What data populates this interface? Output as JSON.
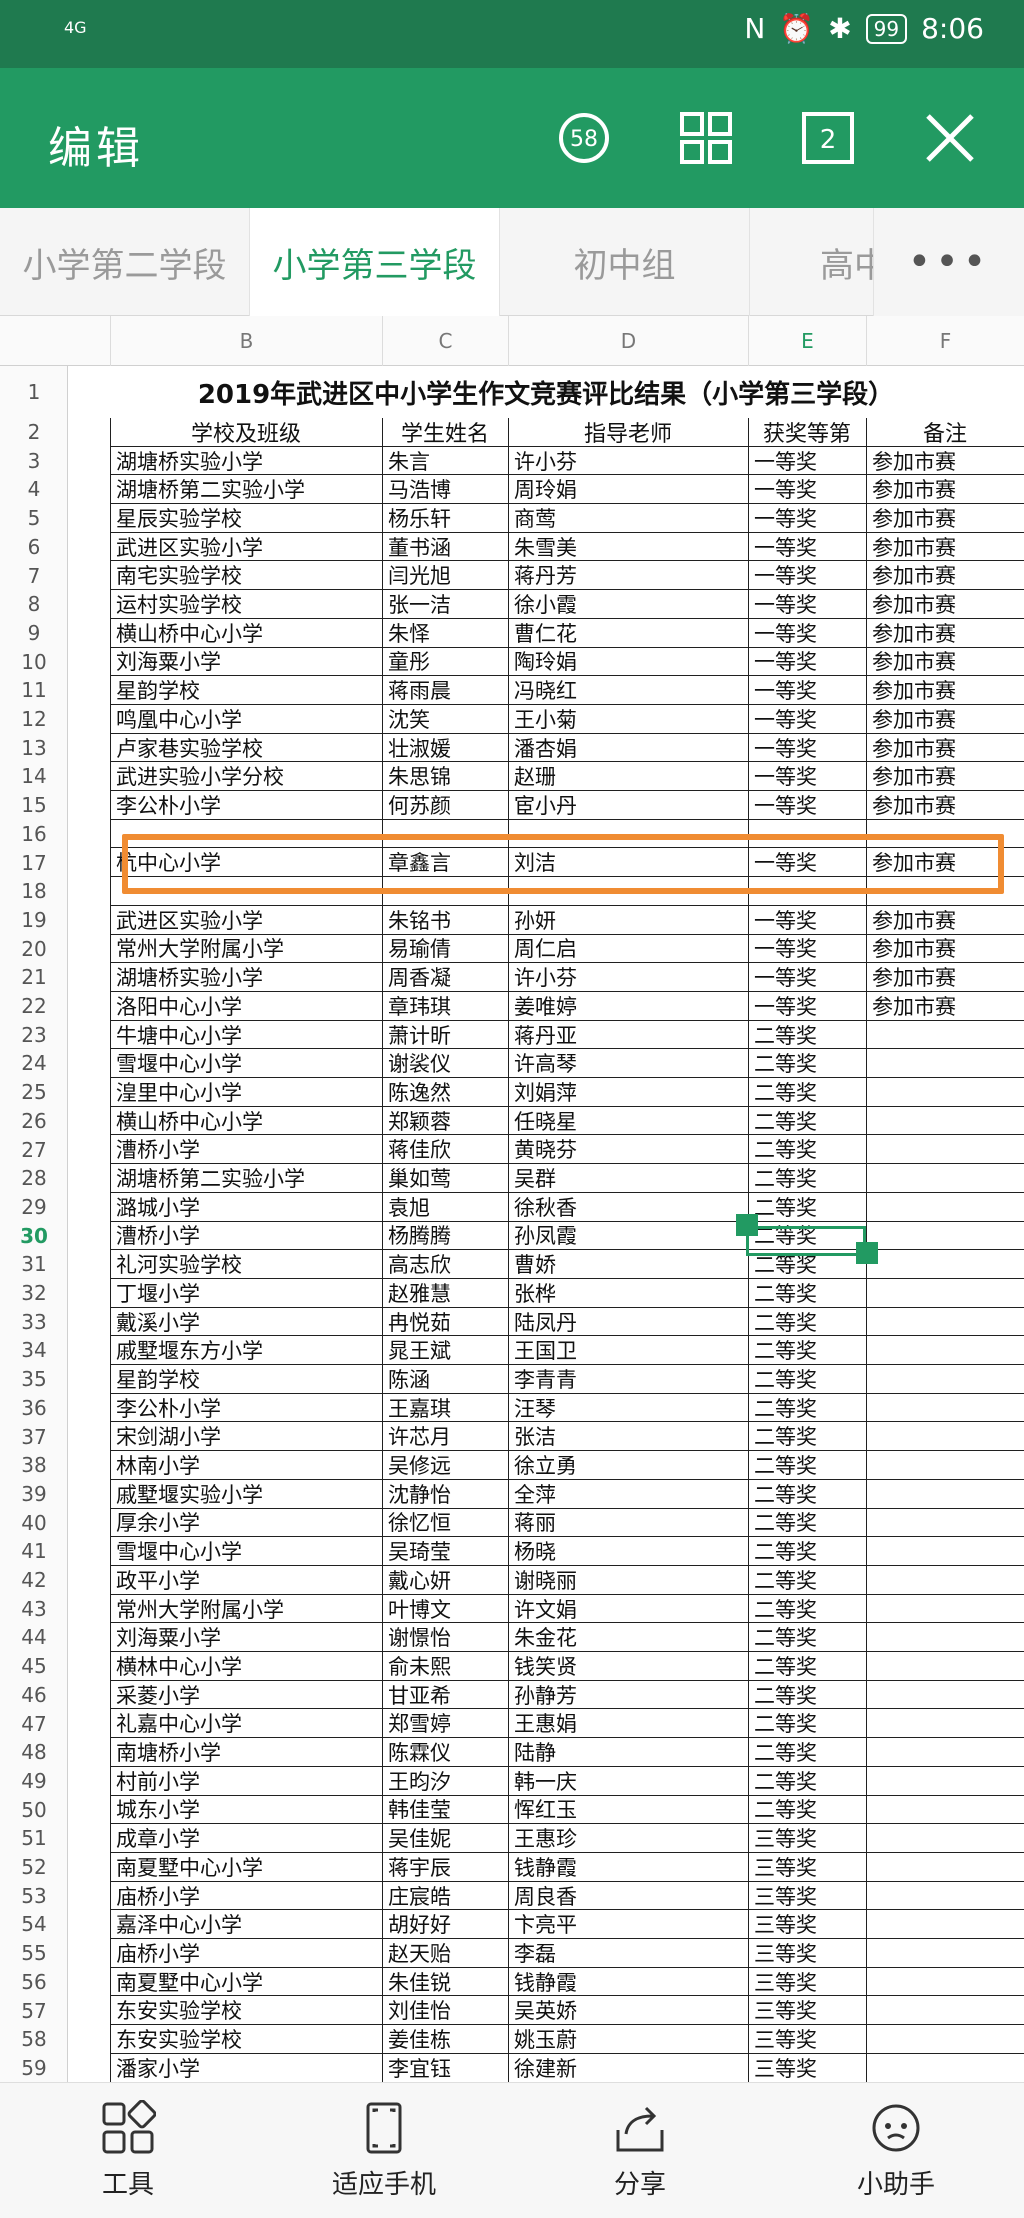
{
  "status_bar": {
    "network": "4G",
    "battery": "99",
    "time": "8:06"
  },
  "app_bar": {
    "title": "编辑",
    "comment_count": "58",
    "page_count": "2"
  },
  "tabs": [
    "小学第二学段",
    "小学第三学段",
    "初中组",
    "高中"
  ],
  "columns": [
    "B",
    "C",
    "D",
    "E",
    "F"
  ],
  "sheet_title": "2019年武进区中小学生作文竞赛评比结果（小学第三学段）",
  "header_row": [
    "学校及班级",
    "学生姓名",
    "指导老师",
    "获奖等第",
    "备注"
  ],
  "rows": [
    [
      "湖塘桥实验小学",
      "朱言",
      "许小芬",
      "一等奖",
      "参加市赛"
    ],
    [
      "湖塘桥第二实验小学",
      "马浩博",
      "周玲娟",
      "一等奖",
      "参加市赛"
    ],
    [
      "星辰实验学校",
      "杨乐轩",
      "商莺",
      "一等奖",
      "参加市赛"
    ],
    [
      "武进区实验小学",
      "董书涵",
      "朱雪美",
      "一等奖",
      "参加市赛"
    ],
    [
      "南宅实验学校",
      "闫光旭",
      "蒋丹芳",
      "一等奖",
      "参加市赛"
    ],
    [
      "运村实验学校",
      "张一洁",
      "徐小霞",
      "一等奖",
      "参加市赛"
    ],
    [
      "横山桥中心小学",
      "朱怿",
      "曹仁花",
      "一等奖",
      "参加市赛"
    ],
    [
      "刘海粟小学",
      "童彤",
      "陶玲娟",
      "一等奖",
      "参加市赛"
    ],
    [
      "星韵学校",
      "蒋雨晨",
      "冯晓红",
      "一等奖",
      "参加市赛"
    ],
    [
      "鸣凰中心小学",
      "沈笑",
      "王小菊",
      "一等奖",
      "参加市赛"
    ],
    [
      "卢家巷实验学校",
      "壮淑媛",
      "潘杏娟",
      "一等奖",
      "参加市赛"
    ],
    [
      "武进实验小学分校",
      "朱思锦",
      "赵珊",
      "一等奖",
      "参加市赛"
    ],
    [
      "李公朴小学",
      "何苏颜",
      "宦小丹",
      "一等奖",
      "参加市赛"
    ],
    [
      "",
      "",
      "",
      "",
      ""
    ],
    [
      "杭中心小学",
      "章鑫言",
      "刘洁",
      "一等奖",
      "参加市赛"
    ],
    [
      "",
      "",
      "",
      "",
      ""
    ],
    [
      "武进区实验小学",
      "朱铭书",
      "孙妍",
      "一等奖",
      "参加市赛"
    ],
    [
      "常州大学附属小学",
      "易瑜倩",
      "周仁启",
      "一等奖",
      "参加市赛"
    ],
    [
      "湖塘桥实验小学",
      "周香凝",
      "许小芬",
      "一等奖",
      "参加市赛"
    ],
    [
      "洛阳中心小学",
      "章玮琪",
      "姜唯婷",
      "一等奖",
      "参加市赛"
    ],
    [
      "牛塘中心小学",
      "萧计昕",
      "蒋丹亚",
      "二等奖",
      ""
    ],
    [
      "雪堰中心小学",
      "谢裟仪",
      "许高琴",
      "二等奖",
      ""
    ],
    [
      "湟里中心小学",
      "陈逸然",
      "刘娟萍",
      "二等奖",
      ""
    ],
    [
      "横山桥中心小学",
      "郑颖蓉",
      "任晓星",
      "二等奖",
      ""
    ],
    [
      "漕桥小学",
      "蒋佳欣",
      "黄晓芬",
      "二等奖",
      ""
    ],
    [
      "湖塘桥第二实验小学",
      "巢如莺",
      "吴群",
      "二等奖",
      ""
    ],
    [
      "潞城小学",
      "袁旭",
      "徐秋香",
      "二等奖",
      ""
    ],
    [
      "漕桥小学",
      "杨腾腾",
      "孙凤霞",
      "二等奖",
      ""
    ],
    [
      "礼河实验学校",
      "高志欣",
      "曹娇",
      "二等奖",
      ""
    ],
    [
      "丁堰小学",
      "赵雅慧",
      "张桦",
      "二等奖",
      ""
    ],
    [
      "戴溪小学",
      "冉悦茹",
      "陆凤丹",
      "二等奖",
      ""
    ],
    [
      "戚墅堰东方小学",
      "晁王斌",
      "王国卫",
      "二等奖",
      ""
    ],
    [
      "星韵学校",
      "陈涵",
      "李青青",
      "二等奖",
      ""
    ],
    [
      "李公朴小学",
      "王嘉琪",
      "汪琴",
      "二等奖",
      ""
    ],
    [
      "宋剑湖小学",
      "许芯月",
      "张洁",
      "二等奖",
      ""
    ],
    [
      "林南小学",
      "吴修远",
      "徐立勇",
      "二等奖",
      ""
    ],
    [
      "戚墅堰实验小学",
      "沈静怡",
      "全萍",
      "二等奖",
      ""
    ],
    [
      "厚余小学",
      "徐忆恒",
      "蒋丽",
      "二等奖",
      ""
    ],
    [
      "雪堰中心小学",
      "吴琦莹",
      "杨晓",
      "二等奖",
      ""
    ],
    [
      "政平小学",
      "戴心妍",
      "谢晓丽",
      "二等奖",
      ""
    ],
    [
      "常州大学附属小学",
      "叶博文",
      "许文娟",
      "二等奖",
      ""
    ],
    [
      "刘海粟小学",
      "谢憬怡",
      "朱金花",
      "二等奖",
      ""
    ],
    [
      "横林中心小学",
      "俞未熙",
      "钱笑贤",
      "二等奖",
      ""
    ],
    [
      "采菱小学",
      "甘亚希",
      "孙静芳",
      "二等奖",
      ""
    ],
    [
      "礼嘉中心小学",
      "郑雪婷",
      "王惠娟",
      "二等奖",
      ""
    ],
    [
      "南塘桥小学",
      "陈霖仪",
      "陆静",
      "二等奖",
      ""
    ],
    [
      "村前小学",
      "王昀汐",
      "韩一庆",
      "二等奖",
      ""
    ],
    [
      "城东小学",
      "韩佳莹",
      "恽红玉",
      "二等奖",
      ""
    ],
    [
      "成章小学",
      "吴佳妮",
      "王惠珍",
      "三等奖",
      ""
    ],
    [
      "南夏墅中心小学",
      "蒋宇辰",
      "钱静霞",
      "三等奖",
      ""
    ],
    [
      "庙桥小学",
      "庄宸皓",
      "周良香",
      "三等奖",
      ""
    ],
    [
      "嘉泽中心小学",
      "胡好好",
      "卞亮平",
      "三等奖",
      ""
    ],
    [
      "庙桥小学",
      "赵天贻",
      "李磊",
      "三等奖",
      ""
    ],
    [
      "南夏墅中心小学",
      "朱佳锐",
      "钱静霞",
      "三等奖",
      ""
    ],
    [
      "东安实验学校",
      "刘佳怡",
      "吴英娇",
      "三等奖",
      ""
    ],
    [
      "东安实验学校",
      "姜佳栋",
      "姚玉蔚",
      "三等奖",
      ""
    ],
    [
      "潘家小学",
      "李宜钰",
      "徐建新",
      "三等奖",
      ""
    ]
  ],
  "bottom_bar": [
    {
      "label": "工具",
      "icon": "tools-icon"
    },
    {
      "label": "适应手机",
      "icon": "fit-phone-icon"
    },
    {
      "label": "分享",
      "icon": "share-icon"
    },
    {
      "label": "小助手",
      "icon": "assistant-icon"
    }
  ],
  "colors": {
    "primary": "#229a62",
    "status_bar": "#1f7a4f",
    "highlight": "#f08c32"
  }
}
